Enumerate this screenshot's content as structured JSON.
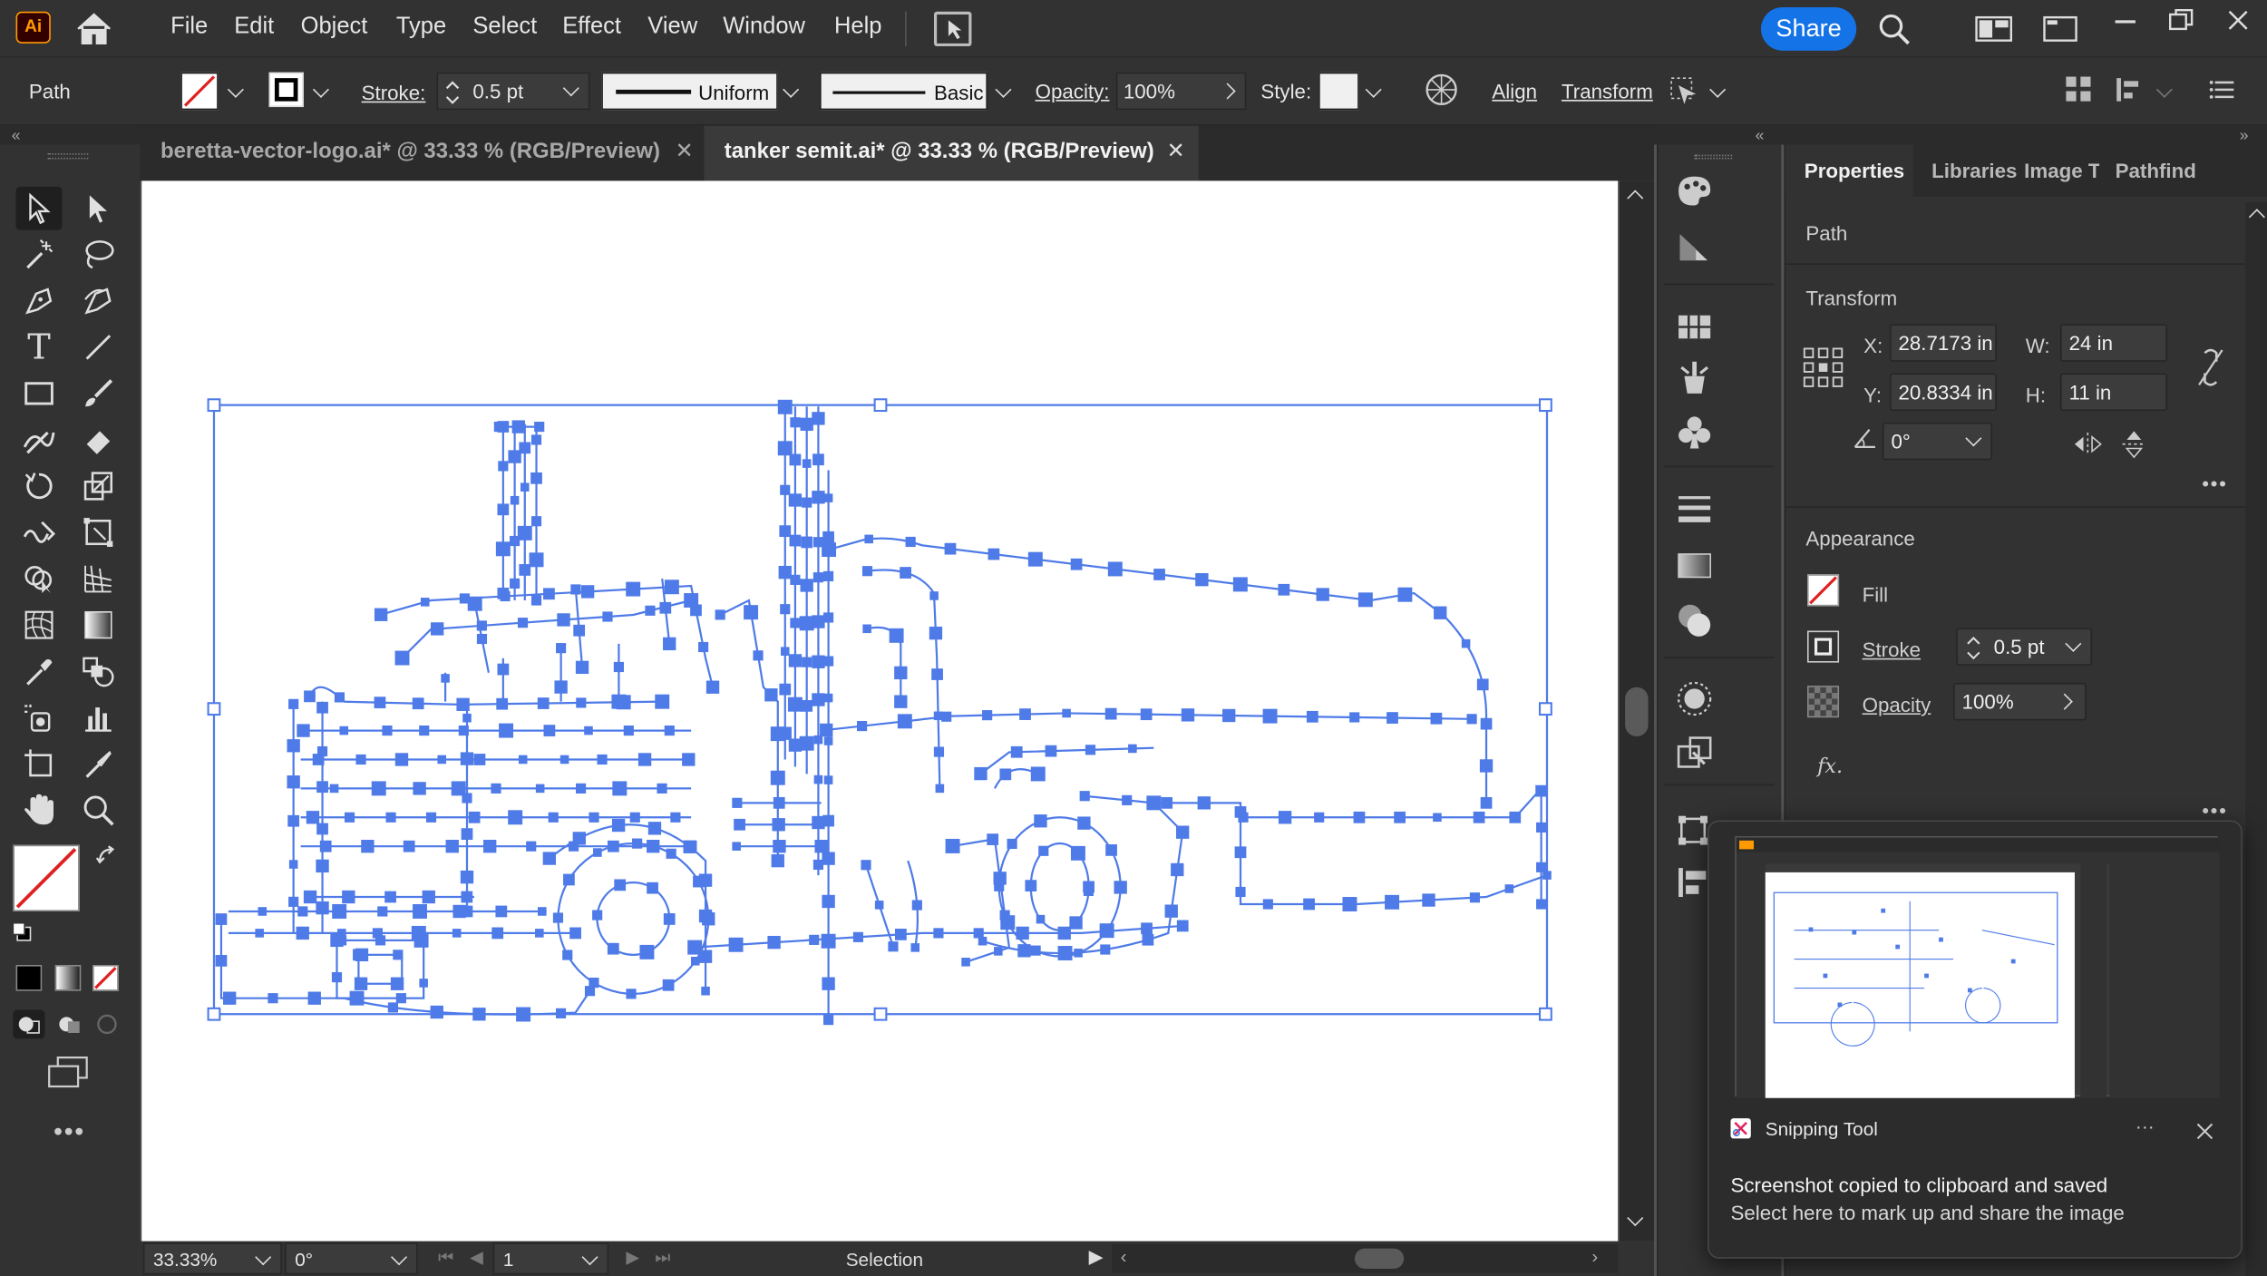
{
  "menu": {
    "app_logo": "Ai",
    "items": [
      "File",
      "Edit",
      "Object",
      "Type",
      "Select",
      "Effect",
      "View",
      "Window",
      "Help"
    ],
    "share_label": "Share"
  },
  "control": {
    "selection_type": "Path",
    "stroke_label": "Stroke:",
    "stroke_value": "0.5 pt",
    "profile_label": "Uniform",
    "brush_label": "Basic",
    "opacity_label": "Opacity:",
    "opacity_value": "100%",
    "style_label": "Style:",
    "align_label": "Align",
    "transform_label": "Transform"
  },
  "tabs": [
    {
      "label": "beretta-vector-logo.ai* @ 33.33 % (RGB/Preview)",
      "active": false
    },
    {
      "label": "tanker semit.ai* @ 33.33 % (RGB/Preview)",
      "active": true
    }
  ],
  "status": {
    "zoom": "33.33%",
    "rotation": "0°",
    "artboard_number": "1",
    "tool_name": "Selection"
  },
  "properties": {
    "tabs": [
      "Properties",
      "Libraries",
      "Image Tr",
      "Pathfind"
    ],
    "object_type": "Path",
    "transform_title": "Transform",
    "x_label": "X:",
    "x_value": "28.7173 in",
    "y_label": "Y:",
    "y_value": "20.8334 in",
    "w_label": "W:",
    "w_value": "24 in",
    "h_label": "H:",
    "h_value": "11 in",
    "angle_value": "0°",
    "appearance_title": "Appearance",
    "fill_label": "Fill",
    "stroke_label": "Stroke",
    "stroke_value": "0.5 pt",
    "opacity_label": "Opacity",
    "opacity_value": "100%",
    "fx_label": "fx."
  },
  "toast": {
    "app_name": "Snipping Tool",
    "line1": "Screenshot copied to clipboard and saved",
    "line2": "Select here to mark up and share the image"
  },
  "colors": {
    "selection_blue": "#4f7be8",
    "accent": "#1473e6",
    "ui_dark": "#323232"
  }
}
